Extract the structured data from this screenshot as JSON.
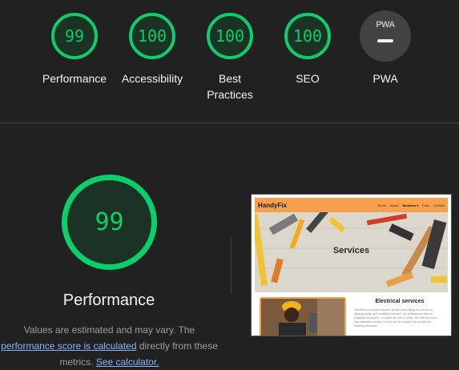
{
  "gauges": [
    {
      "score": "99",
      "label": "Performance"
    },
    {
      "score": "100",
      "label": "Accessibility"
    },
    {
      "score": "100",
      "label": "Best Practices"
    },
    {
      "score": "100",
      "label": "SEO"
    }
  ],
  "pwa": {
    "badge_text": "PWA",
    "label": "PWA"
  },
  "performance": {
    "score": "99",
    "title": "Performance",
    "desc_prefix": "Values are estimated and may vary. The",
    "link1": "performance score is calculated",
    "desc_middle": "directly from these metrics.",
    "link2": "See calculator."
  },
  "preview": {
    "logo": "HandyFix",
    "nav": [
      "Home",
      "About",
      "Services ▾",
      "Price",
      "Contact"
    ],
    "hero_title": "Services",
    "section_title": "Electrical services",
    "section_body": "Whether you require a simple smoke alarm fitting or a full-fit out lighting design and installation service, our professional team is available for all jobs, no matter the size or scale. We offer low-cost, high standard services on time and on budget. We provide the following electrical"
  },
  "colors": {
    "pass": "#0cce6b",
    "pass_bg": "#1b3325",
    "background": "#212121",
    "accent": "#f6a04d"
  }
}
